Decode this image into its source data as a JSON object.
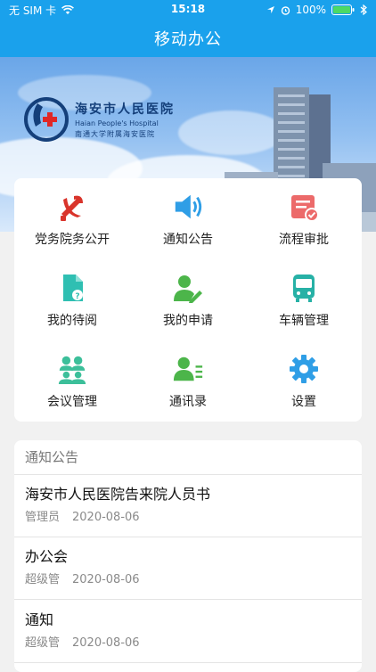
{
  "status_bar": {
    "carrier": "无 SIM 卡",
    "time": "15:18",
    "battery": "100%"
  },
  "nav": {
    "title": "移动办公"
  },
  "banner": {
    "hospital_name_cn": "海安市人民医院",
    "hospital_name_en": "Haian People's Hospital",
    "hospital_sub": "南通大学附属海安医院"
  },
  "menu": [
    {
      "label": "党务院务公开",
      "icon": "party-emblem-icon",
      "color": "#d9342b"
    },
    {
      "label": "通知公告",
      "icon": "speaker-icon",
      "color": "#2f9ee6"
    },
    {
      "label": "流程审批",
      "icon": "approval-icon",
      "color": "#ec6a6a"
    },
    {
      "label": "我的待阅",
      "icon": "document-question-icon",
      "color": "#2fbfb2"
    },
    {
      "label": "我的申请",
      "icon": "user-edit-icon",
      "color": "#4cb54a"
    },
    {
      "label": "车辆管理",
      "icon": "bus-icon",
      "color": "#27b1a6"
    },
    {
      "label": "会议管理",
      "icon": "meeting-icon",
      "color": "#3cbf9a"
    },
    {
      "label": "通讯录",
      "icon": "contacts-icon",
      "color": "#4cb54a"
    },
    {
      "label": "设置",
      "icon": "gear-icon",
      "color": "#2f9ee6"
    }
  ],
  "notices": {
    "header": "通知公告",
    "items": [
      {
        "title": "海安市人民医院告来院人员书",
        "author": "管理员",
        "date": "2020-08-06"
      },
      {
        "title": "办公会",
        "author": "超级管",
        "date": "2020-08-06"
      },
      {
        "title": "通知",
        "author": "超级管",
        "date": "2020-08-06"
      }
    ]
  }
}
